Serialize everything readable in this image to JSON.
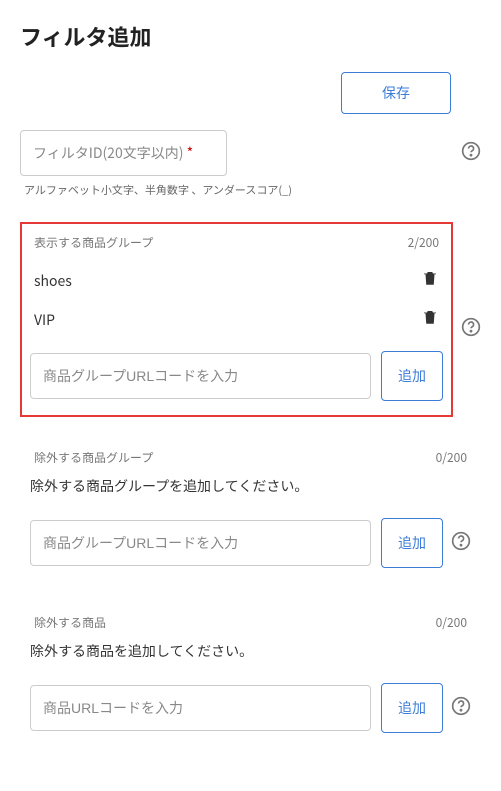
{
  "page": {
    "title": "フィルタ追加"
  },
  "buttons": {
    "save": "保存",
    "add": "追加"
  },
  "filterId": {
    "placeholder": "フィルタID(20文字以内)",
    "required": "*",
    "hint": "アルファベット小文字、半角数字 、アンダースコア(_)"
  },
  "displayGroup": {
    "label": "表示する商品グループ",
    "count": "2/200",
    "items": [
      {
        "name": "shoes"
      },
      {
        "name": "VIP"
      }
    ],
    "inputPlaceholder": "商品グループURLコードを入力"
  },
  "excludeGroup": {
    "label": "除外する商品グループ",
    "count": "0/200",
    "emptyMsg": "除外する商品グループを追加してください。",
    "inputPlaceholder": "商品グループURLコードを入力"
  },
  "excludeProduct": {
    "label": "除外する商品",
    "count": "0/200",
    "emptyMsg": "除外する商品を追加してください。",
    "inputPlaceholder": "商品URLコードを入力"
  }
}
